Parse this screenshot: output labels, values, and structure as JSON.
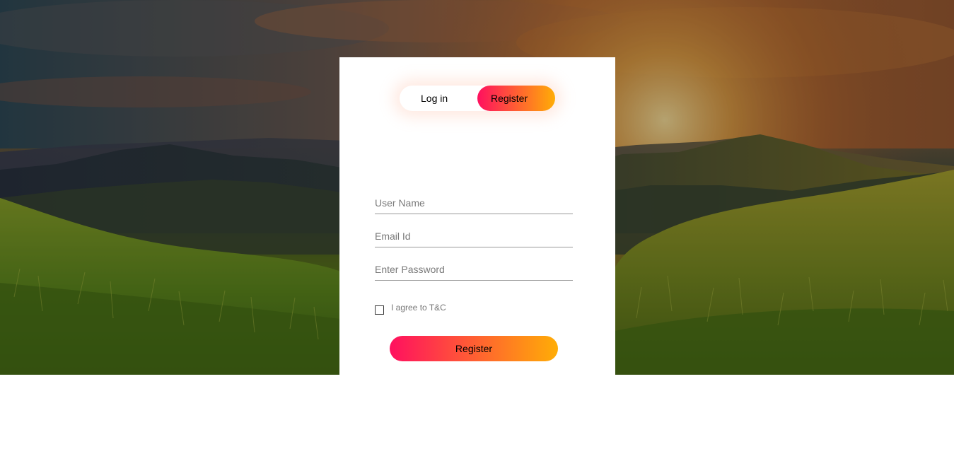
{
  "background": {
    "scene": "mountain-sunset-grass-landscape"
  },
  "auth": {
    "toggle": {
      "login_label": "Log in",
      "register_label": "Register",
      "active": "Register"
    },
    "fields": {
      "username_placeholder": "User Name",
      "email_placeholder": "Email Id",
      "password_placeholder": "Enter Password"
    },
    "terms_label": "I agree to T&C",
    "terms_checked": false,
    "submit_label": "Register"
  },
  "colors": {
    "gradient_start": "#ff105f",
    "gradient_end": "#ffad06"
  }
}
